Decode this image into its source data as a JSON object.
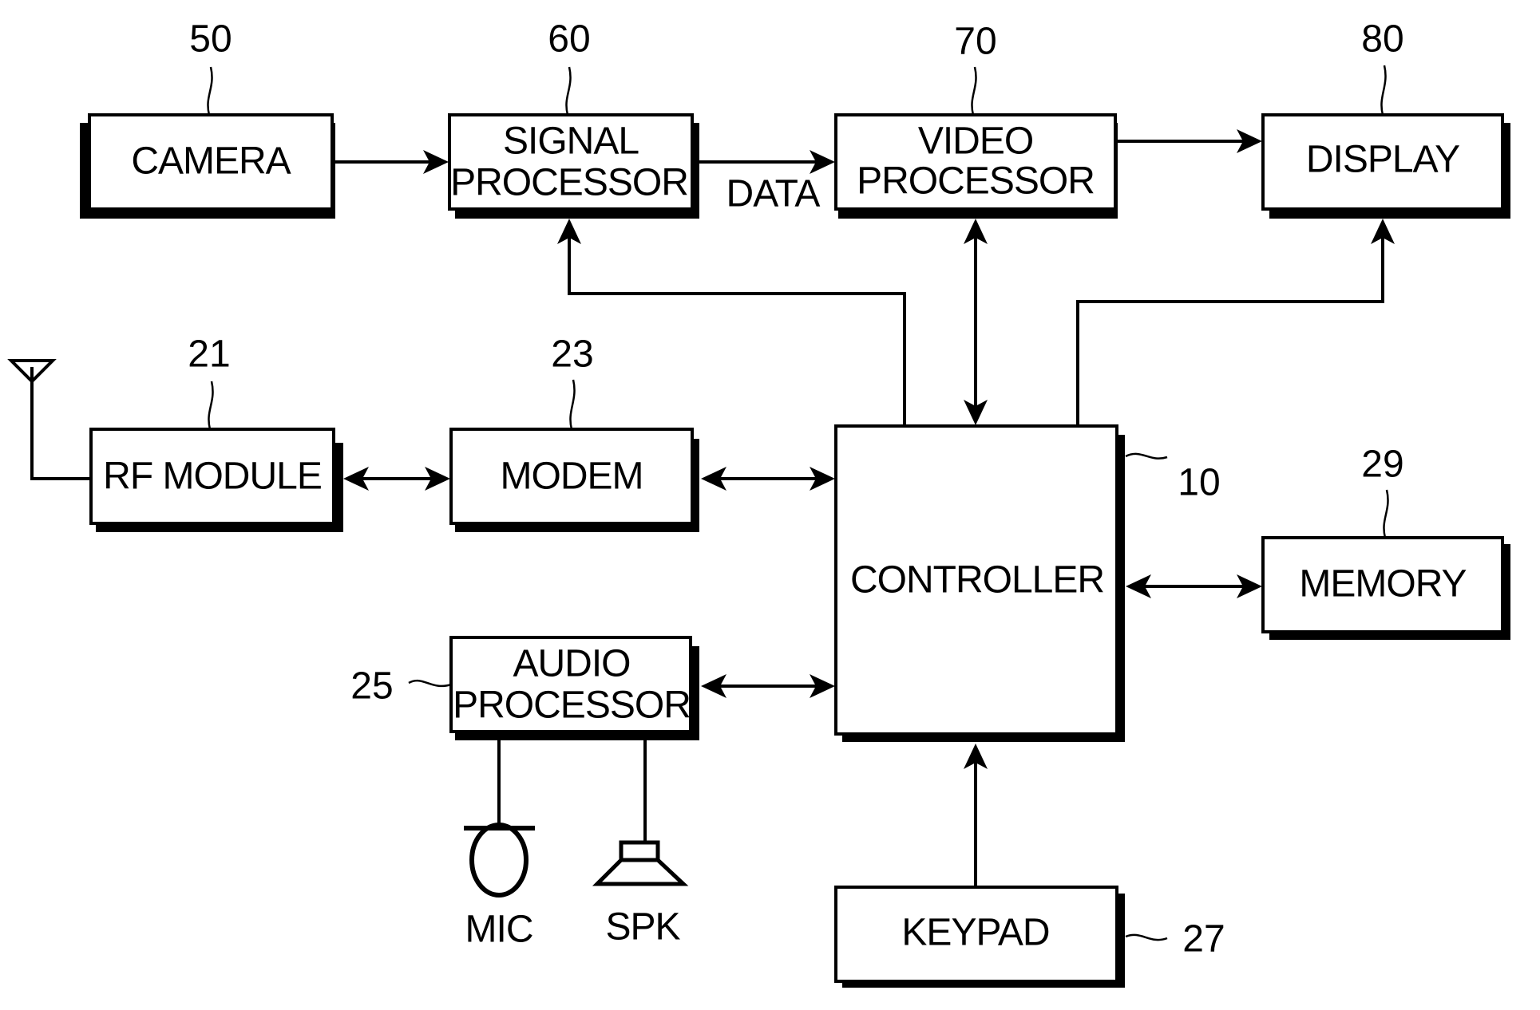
{
  "diagram": {
    "type": "block-diagram",
    "blocks": [
      {
        "id": "camera",
        "label": [
          "CAMERA"
        ],
        "ref": "50"
      },
      {
        "id": "signal_processor",
        "label": [
          "SIGNAL",
          "PROCESSOR"
        ],
        "ref": "60"
      },
      {
        "id": "video_processor",
        "label": [
          "VIDEO",
          "PROCESSOR"
        ],
        "ref": "70"
      },
      {
        "id": "display",
        "label": [
          "DISPLAY"
        ],
        "ref": "80"
      },
      {
        "id": "rf_module",
        "label": [
          "RF MODULE"
        ],
        "ref": "21"
      },
      {
        "id": "modem",
        "label": [
          "MODEM"
        ],
        "ref": "23"
      },
      {
        "id": "controller",
        "label": [
          "CONTROLLER"
        ],
        "ref": "10"
      },
      {
        "id": "memory",
        "label": [
          "MEMORY"
        ],
        "ref": "29"
      },
      {
        "id": "audio_processor",
        "label": [
          "AUDIO",
          "PROCESSOR"
        ],
        "ref": "25"
      },
      {
        "id": "keypad",
        "label": [
          "KEYPAD"
        ],
        "ref": "27"
      }
    ],
    "peripherals": [
      {
        "id": "mic",
        "label": "MIC",
        "icon": "microphone-icon"
      },
      {
        "id": "spk",
        "label": "SPK",
        "icon": "speaker-icon"
      },
      {
        "id": "antenna",
        "label": "",
        "icon": "antenna-icon"
      }
    ],
    "edge_labels": {
      "data": "DATA"
    },
    "connections": [
      {
        "from": "camera",
        "to": "signal_processor",
        "dir": "forward"
      },
      {
        "from": "signal_processor",
        "to": "video_processor",
        "dir": "forward",
        "label": "DATA"
      },
      {
        "from": "video_processor",
        "to": "display",
        "dir": "forward"
      },
      {
        "from": "controller",
        "to": "signal_processor",
        "dir": "forward"
      },
      {
        "from": "controller",
        "to": "video_processor",
        "dir": "both"
      },
      {
        "from": "controller",
        "to": "display",
        "dir": "forward"
      },
      {
        "from": "rf_module",
        "to": "modem",
        "dir": "both"
      },
      {
        "from": "modem",
        "to": "controller",
        "dir": "both"
      },
      {
        "from": "controller",
        "to": "memory",
        "dir": "both"
      },
      {
        "from": "audio_processor",
        "to": "controller",
        "dir": "both"
      },
      {
        "from": "keypad",
        "to": "controller",
        "dir": "forward"
      },
      {
        "from": "antenna",
        "to": "rf_module",
        "dir": "none"
      },
      {
        "from": "audio_processor",
        "to": "mic",
        "dir": "none"
      },
      {
        "from": "audio_processor",
        "to": "spk",
        "dir": "none"
      }
    ]
  }
}
